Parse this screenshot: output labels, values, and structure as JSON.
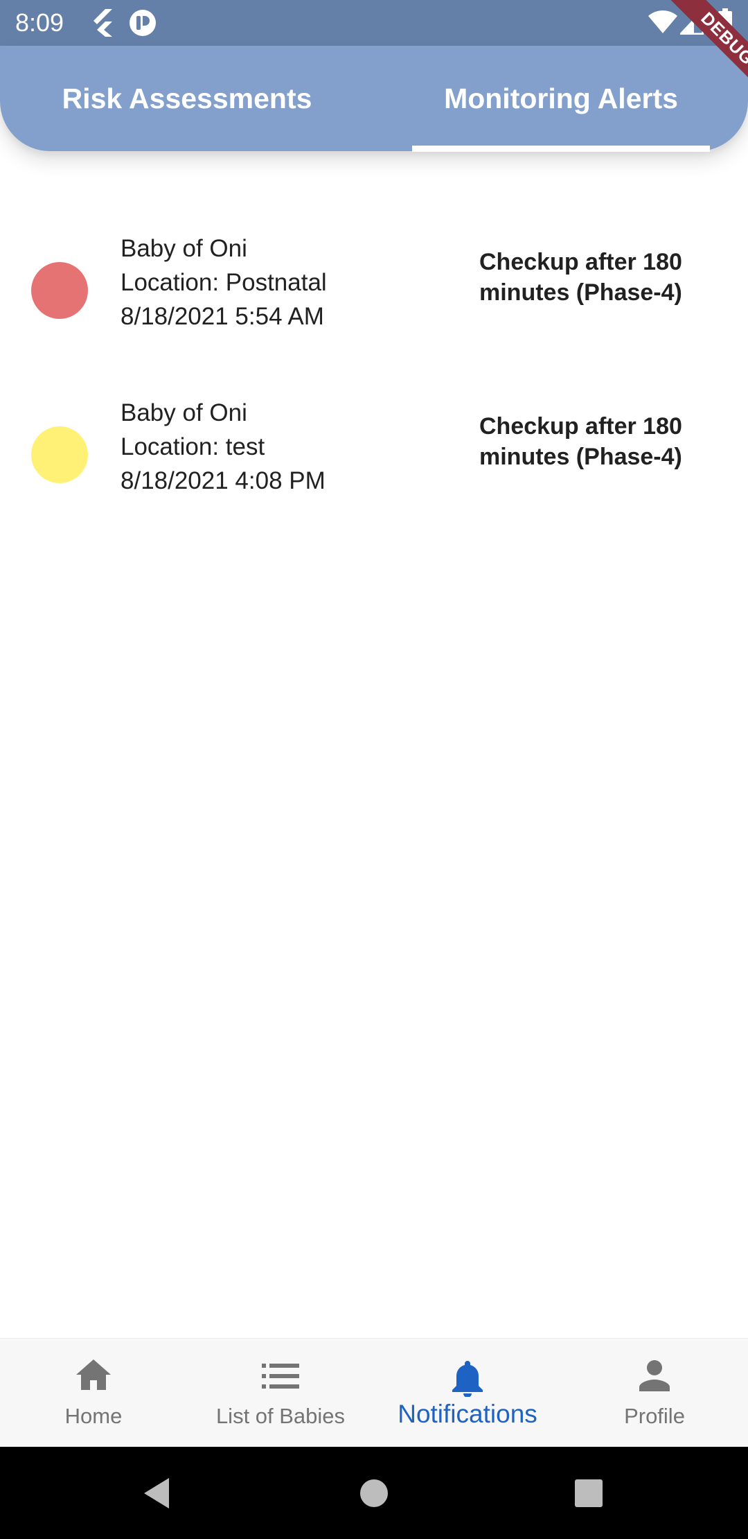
{
  "status_bar": {
    "time": "8:09",
    "icons": [
      "flutter-icon",
      "app-notification-icon",
      "wifi-icon",
      "signal-icon",
      "battery-icon"
    ],
    "color": "#6580a8"
  },
  "tabs": {
    "items": [
      {
        "label": "Risk Assessments",
        "active": false
      },
      {
        "label": "Monitoring Alerts",
        "active": true
      }
    ],
    "background": "#83a0cc"
  },
  "debug_banner": "DEBUG",
  "alerts": [
    {
      "dot_color": "#e57373",
      "name": "Baby of Oni",
      "location": "Location: Postnatal",
      "datetime": "8/18/2021 5:54 AM",
      "status": "Checkup after 180 minutes (Phase-4)"
    },
    {
      "dot_color": "#fff176",
      "name": "Baby of Oni",
      "location": "Location: test",
      "datetime": "8/18/2021 4:08 PM",
      "status": "Checkup after 180 minutes (Phase-4)"
    }
  ],
  "bottom_nav": {
    "items": [
      {
        "label": "Home",
        "icon": "home-icon",
        "active": false
      },
      {
        "label": "List of Babies",
        "icon": "list-icon",
        "active": false
      },
      {
        "label": "Notifications",
        "icon": "bell-icon",
        "active": true
      },
      {
        "label": "Profile",
        "icon": "person-icon",
        "active": false
      }
    ],
    "active_color": "#1e63c3",
    "inactive_color": "#747474"
  },
  "system_nav": {
    "buttons": [
      "back-button",
      "home-button",
      "recents-button"
    ]
  }
}
